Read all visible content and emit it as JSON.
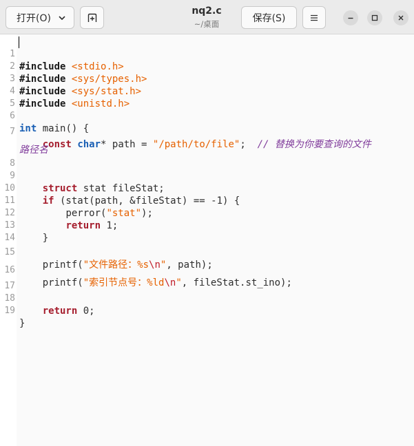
{
  "header": {
    "open_label": "打开(O)",
    "save_label": "保存(S)",
    "title": "nq2.c",
    "subtitle": "~/桌面"
  },
  "code": {
    "l1": [
      "#include",
      "<stdio.h>"
    ],
    "l2": [
      "#include",
      "<sys/types.h>"
    ],
    "l3": [
      "#include",
      "<sys/stat.h>"
    ],
    "l4": [
      "#include",
      "<unistd.h>"
    ],
    "l6": [
      "int",
      "main() {"
    ],
    "l7": [
      "const",
      "char",
      "* path = ",
      "\"/path/to/file\"",
      ";",
      "// 替换为你要查询的文件"
    ],
    "l7b": "路径名",
    "l9": [
      "struct",
      "stat fileStat;"
    ],
    "l10": [
      "if",
      " (stat(path, &fileStat) == -1) {"
    ],
    "l11": [
      "perror(",
      "\"stat\"",
      ");"
    ],
    "l12": [
      "return",
      " 1;"
    ],
    "l13": "}",
    "l15": [
      "printf(",
      "\"文件路径：%s",
      "\\n",
      "\"",
      ", path);"
    ],
    "l16": [
      "printf(",
      "\"索引节点号：%ld",
      "\\n",
      "\"",
      ", fileStat.st_ino);"
    ],
    "l18": [
      "return",
      " 0;"
    ],
    "l19": "}"
  },
  "line_numbers": [
    "1",
    "2",
    "3",
    "4",
    "5",
    "6",
    "7",
    "8",
    "9",
    "10",
    "11",
    "12",
    "13",
    "14",
    "15",
    "16",
    "17",
    "18",
    "19"
  ]
}
